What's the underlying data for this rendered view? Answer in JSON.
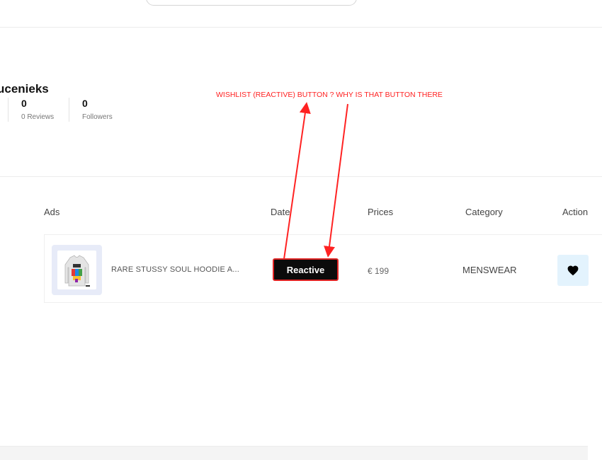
{
  "profile": {
    "name": "ucenieks",
    "stats": [
      {
        "value": "0",
        "label": "0 Reviews"
      },
      {
        "value": "0",
        "label": "Followers"
      }
    ]
  },
  "table": {
    "headers": [
      "Ads",
      "Date",
      "Prices",
      "Category",
      "Action"
    ],
    "rows": [
      {
        "product_name": "RARE STUSSY SOUL HOODIE A...",
        "status_button": "Reactive",
        "price": "€ 199",
        "category": "MENSWEAR",
        "action_icon": "heart-icon"
      }
    ]
  },
  "annotation": {
    "text": "WISHLIST (REACTIVE) BUTTON ? WHY IS THAT BUTTON THERE",
    "color": "#ff2222"
  },
  "colors": {
    "status_button_bg": "#0b0b0b",
    "status_button_border": "#e02424",
    "action_button_bg": "#e3f3fd"
  }
}
